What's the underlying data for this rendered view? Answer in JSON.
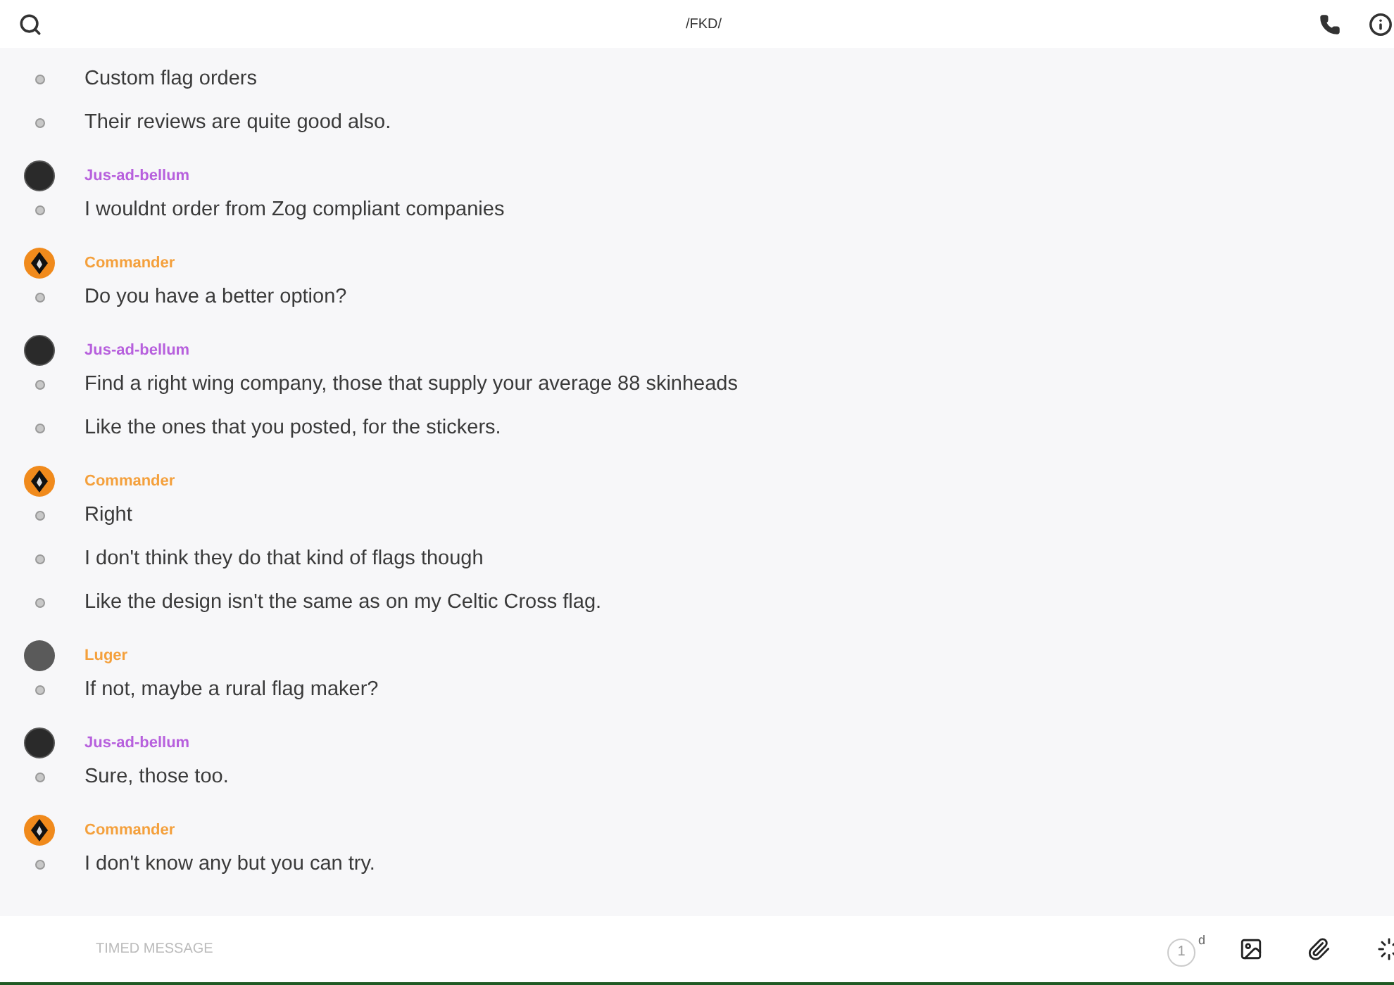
{
  "header": {
    "title": "/FKD/"
  },
  "groups": [
    {
      "lines": [
        "Custom flag orders",
        "Their reviews are quite good also."
      ]
    },
    {
      "sender": {
        "name": "Jus-ad-bellum",
        "color": "#b760dd",
        "avatar": {
          "kind": "dark"
        }
      },
      "lines": [
        "I wouldnt order from Zog compliant companies"
      ]
    },
    {
      "sender": {
        "name": "Commander",
        "color": "#f4a03c",
        "avatar": {
          "kind": "emblem"
        }
      },
      "lines": [
        "Do you have a better option?"
      ]
    },
    {
      "sender": {
        "name": "Jus-ad-bellum",
        "color": "#b760dd",
        "avatar": {
          "kind": "dark"
        }
      },
      "lines": [
        "Find a right wing company, those that supply your average 88 skinheads",
        "Like the ones that you posted, for the stickers."
      ]
    },
    {
      "sender": {
        "name": "Commander",
        "color": "#f4a03c",
        "avatar": {
          "kind": "emblem"
        }
      },
      "lines": [
        "Right",
        "I don't think they do that kind of flags though",
        "Like the design isn't the same as on my Celtic Cross flag."
      ]
    },
    {
      "sender": {
        "name": "Luger",
        "color": "#f4a03c",
        "avatar": {
          "kind": "photo"
        }
      },
      "lines": [
        "If not, maybe a rural flag maker?"
      ]
    },
    {
      "sender": {
        "name": "Jus-ad-bellum",
        "color": "#b760dd",
        "avatar": {
          "kind": "dark"
        }
      },
      "lines": [
        "Sure, those too."
      ]
    },
    {
      "sender": {
        "name": "Commander",
        "color": "#f4a03c",
        "avatar": {
          "kind": "emblem"
        }
      },
      "lines": [
        "I don't know any but you can try."
      ]
    }
  ],
  "composer": {
    "placeholder": "TIMED MESSAGE",
    "timer_value": "1",
    "timer_unit": "d"
  }
}
